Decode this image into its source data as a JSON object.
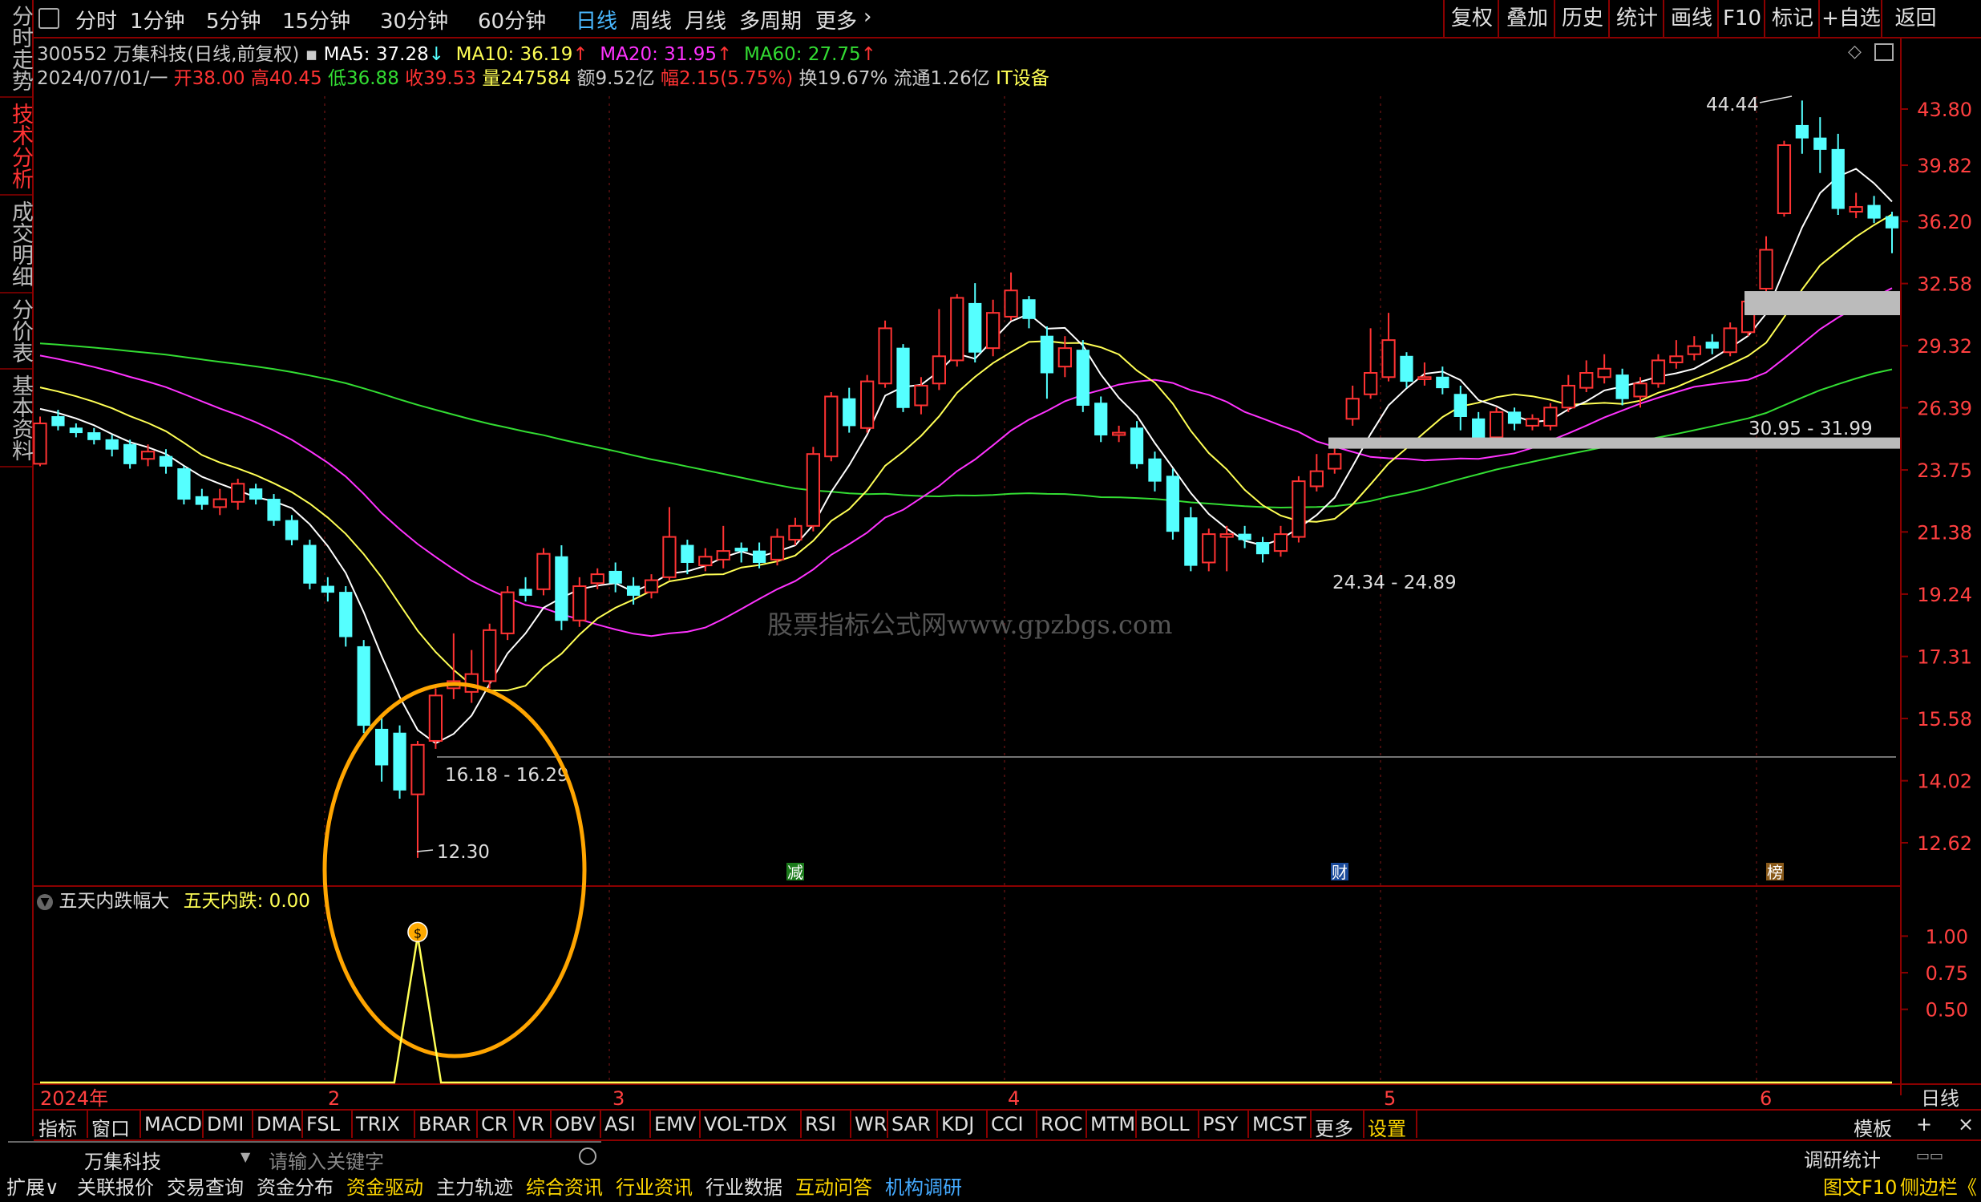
{
  "sidebar": {
    "tabs": [
      "分时走势",
      "技术分析",
      "成交明细",
      "分价表",
      "基本资料"
    ],
    "active_index": 1
  },
  "topbar": {
    "periods": [
      "分时",
      "1分钟",
      "5分钟",
      "15分钟",
      "30分钟",
      "60分钟",
      "日线",
      "周线",
      "月线",
      "多周期",
      "更多"
    ],
    "active_period": "日线",
    "more_arrow": "›",
    "right_items": [
      "复权",
      "叠加",
      "历史",
      "统计",
      "画线",
      "F10",
      "标记",
      "+自选",
      "返回"
    ]
  },
  "info": {
    "stock": "300552 万集科技(日线,前复权)",
    "ma5": "MA5: 37.28",
    "ma10": "MA10: 36.19",
    "ma20": "MA20: 31.95",
    "ma60": "MA60: 27.75",
    "date": "2024/07/01/一",
    "open": "开38.00",
    "high": "高40.45",
    "low": "低36.88",
    "close": "收39.53",
    "vol": "量247584",
    "amount": "额9.52亿",
    "change": "幅2.15(5.75%)",
    "turnover": "换19.67%",
    "float": "流通1.26亿",
    "industry": "IT设备"
  },
  "colors": {
    "ma5": "#ffffff",
    "ma10": "#ffff55",
    "ma20": "#ff33ff",
    "ma60": "#33dd33",
    "up": "#ff3333",
    "down": "#55ffff",
    "accent": "#4ab8ff",
    "frame": "#8b0000",
    "circle": "#ffa500"
  },
  "chart_data": {
    "type": "candlestick",
    "price_axis_ticks": [
      "43.80",
      "39.82",
      "36.20",
      "32.58",
      "29.32",
      "26.39",
      "23.75",
      "21.38",
      "19.24",
      "17.31",
      "15.58",
      "14.02",
      "12.62"
    ],
    "indicator_axis_ticks": [
      "1.00",
      "0.75",
      "0.50"
    ],
    "x_labels": [
      "2024年",
      "2",
      "3",
      "4",
      "5",
      "6"
    ],
    "annotations": {
      "high_label": "44.44",
      "low_label": "12.30",
      "zone1": "16.18 - 16.29",
      "zone2": "24.34 - 24.89",
      "zone3": "30.95 - 31.99"
    },
    "markers": [
      "减",
      "财",
      "榜"
    ],
    "watermark": "股票指标公式网www.gpzbgs.com",
    "indicator": {
      "name": "五天内跌幅大",
      "value_label": "五天内跌: 0.00",
      "peak_value": 1.0,
      "signal_icon": "$"
    },
    "candles": [
      {
        "o": 24.0,
        "c": 25.7,
        "h": 26.0,
        "l": 23.9
      },
      {
        "o": 26.0,
        "c": 25.6,
        "h": 26.3,
        "l": 25.4
      },
      {
        "o": 25.5,
        "c": 25.3,
        "h": 25.7,
        "l": 25.1
      },
      {
        "o": 25.3,
        "c": 25.0,
        "h": 25.5,
        "l": 24.8
      },
      {
        "o": 25.0,
        "c": 24.6,
        "h": 25.2,
        "l": 24.3
      },
      {
        "o": 24.8,
        "c": 24.0,
        "h": 25.0,
        "l": 23.8
      },
      {
        "o": 24.2,
        "c": 24.5,
        "h": 24.8,
        "l": 23.9
      },
      {
        "o": 24.3,
        "c": 23.9,
        "h": 24.6,
        "l": 23.6
      },
      {
        "o": 23.8,
        "c": 22.6,
        "h": 23.9,
        "l": 22.4
      },
      {
        "o": 22.7,
        "c": 22.4,
        "h": 23.0,
        "l": 22.2
      },
      {
        "o": 22.3,
        "c": 22.6,
        "h": 23.0,
        "l": 22.0
      },
      {
        "o": 22.5,
        "c": 23.2,
        "h": 23.4,
        "l": 22.2
      },
      {
        "o": 23.0,
        "c": 22.6,
        "h": 23.2,
        "l": 22.4
      },
      {
        "o": 22.6,
        "c": 21.8,
        "h": 22.8,
        "l": 21.6
      },
      {
        "o": 21.8,
        "c": 21.1,
        "h": 22.0,
        "l": 20.9
      },
      {
        "o": 20.9,
        "c": 19.6,
        "h": 21.1,
        "l": 19.4
      },
      {
        "o": 19.5,
        "c": 19.3,
        "h": 19.8,
        "l": 19.0
      },
      {
        "o": 19.3,
        "c": 17.9,
        "h": 19.5,
        "l": 17.6
      },
      {
        "o": 17.6,
        "c": 15.4,
        "h": 17.8,
        "l": 15.2
      },
      {
        "o": 15.3,
        "c": 14.4,
        "h": 15.6,
        "l": 14.0
      },
      {
        "o": 15.2,
        "c": 13.8,
        "h": 15.4,
        "l": 13.6
      },
      {
        "o": 13.7,
        "c": 14.9,
        "h": 15.0,
        "l": 12.3
      },
      {
        "o": 15.0,
        "c": 16.2,
        "h": 16.4,
        "l": 14.8
      },
      {
        "o": 16.4,
        "c": 16.6,
        "h": 18.0,
        "l": 16.1
      },
      {
        "o": 16.3,
        "c": 16.8,
        "h": 17.5,
        "l": 16.0
      },
      {
        "o": 16.6,
        "c": 18.1,
        "h": 18.3,
        "l": 16.4
      },
      {
        "o": 18.0,
        "c": 19.3,
        "h": 19.5,
        "l": 17.8
      },
      {
        "o": 19.4,
        "c": 19.2,
        "h": 19.8,
        "l": 19.0
      },
      {
        "o": 19.4,
        "c": 20.6,
        "h": 20.8,
        "l": 19.2
      },
      {
        "o": 20.5,
        "c": 18.4,
        "h": 20.9,
        "l": 18.1
      },
      {
        "o": 18.4,
        "c": 19.5,
        "h": 19.8,
        "l": 18.2
      },
      {
        "o": 19.6,
        "c": 19.9,
        "h": 20.1,
        "l": 19.4
      },
      {
        "o": 20.0,
        "c": 19.6,
        "h": 20.3,
        "l": 19.3
      },
      {
        "o": 19.5,
        "c": 19.2,
        "h": 19.8,
        "l": 18.9
      },
      {
        "o": 19.3,
        "c": 19.7,
        "h": 19.9,
        "l": 19.1
      },
      {
        "o": 19.8,
        "c": 21.2,
        "h": 22.3,
        "l": 19.7
      },
      {
        "o": 20.9,
        "c": 20.3,
        "h": 21.1,
        "l": 19.9
      },
      {
        "o": 20.2,
        "c": 20.5,
        "h": 20.8,
        "l": 20.0
      },
      {
        "o": 20.4,
        "c": 20.7,
        "h": 21.6,
        "l": 20.1
      },
      {
        "o": 20.8,
        "c": 20.7,
        "h": 21.0,
        "l": 20.3
      },
      {
        "o": 20.7,
        "c": 20.3,
        "h": 21.0,
        "l": 20.1
      },
      {
        "o": 20.4,
        "c": 21.2,
        "h": 21.5,
        "l": 20.2
      },
      {
        "o": 21.1,
        "c": 21.6,
        "h": 21.9,
        "l": 20.9
      },
      {
        "o": 21.6,
        "c": 24.4,
        "h": 24.7,
        "l": 21.4
      },
      {
        "o": 24.3,
        "c": 26.9,
        "h": 27.1,
        "l": 24.1
      },
      {
        "o": 26.8,
        "c": 25.6,
        "h": 27.3,
        "l": 25.3
      },
      {
        "o": 25.5,
        "c": 27.6,
        "h": 27.9,
        "l": 25.3
      },
      {
        "o": 27.5,
        "c": 30.2,
        "h": 30.6,
        "l": 27.3
      },
      {
        "o": 29.2,
        "c": 26.4,
        "h": 29.4,
        "l": 26.2
      },
      {
        "o": 26.5,
        "c": 27.4,
        "h": 27.8,
        "l": 26.1
      },
      {
        "o": 27.5,
        "c": 28.8,
        "h": 31.2,
        "l": 27.2
      },
      {
        "o": 28.6,
        "c": 31.8,
        "h": 32.0,
        "l": 28.3
      },
      {
        "o": 31.5,
        "c": 29.0,
        "h": 32.6,
        "l": 28.5
      },
      {
        "o": 29.2,
        "c": 31.0,
        "h": 31.7,
        "l": 28.8
      },
      {
        "o": 30.8,
        "c": 32.2,
        "h": 33.2,
        "l": 30.6
      },
      {
        "o": 31.7,
        "c": 30.7,
        "h": 31.9,
        "l": 30.2
      },
      {
        "o": 29.8,
        "c": 28.0,
        "h": 30.3,
        "l": 26.8
      },
      {
        "o": 28.3,
        "c": 29.2,
        "h": 29.8,
        "l": 27.8
      },
      {
        "o": 29.1,
        "c": 26.5,
        "h": 29.6,
        "l": 26.2
      },
      {
        "o": 26.6,
        "c": 25.2,
        "h": 26.9,
        "l": 24.9
      },
      {
        "o": 25.2,
        "c": 25.3,
        "h": 25.6,
        "l": 24.9
      },
      {
        "o": 25.5,
        "c": 24.0,
        "h": 25.8,
        "l": 23.8
      },
      {
        "o": 24.2,
        "c": 23.3,
        "h": 24.5,
        "l": 22.9
      },
      {
        "o": 23.5,
        "c": 21.4,
        "h": 23.8,
        "l": 21.1
      },
      {
        "o": 21.9,
        "c": 20.2,
        "h": 22.3,
        "l": 20.0
      },
      {
        "o": 20.3,
        "c": 21.3,
        "h": 21.5,
        "l": 20.0
      },
      {
        "o": 21.2,
        "c": 21.3,
        "h": 21.6,
        "l": 20.0
      },
      {
        "o": 21.3,
        "c": 21.1,
        "h": 21.6,
        "l": 20.8
      },
      {
        "o": 21.0,
        "c": 20.6,
        "h": 21.2,
        "l": 20.3
      },
      {
        "o": 20.7,
        "c": 21.3,
        "h": 21.6,
        "l": 20.5
      },
      {
        "o": 21.2,
        "c": 23.3,
        "h": 23.5,
        "l": 21.0
      },
      {
        "o": 23.1,
        "c": 23.7,
        "h": 24.4,
        "l": 22.9
      },
      {
        "o": 23.8,
        "c": 24.4,
        "h": 24.7,
        "l": 23.6
      },
      {
        "o": 25.9,
        "c": 26.8,
        "h": 27.4,
        "l": 25.6
      },
      {
        "o": 27.0,
        "c": 28.0,
        "h": 30.2,
        "l": 26.8
      },
      {
        "o": 27.8,
        "c": 29.6,
        "h": 31.0,
        "l": 27.6
      },
      {
        "o": 28.8,
        "c": 27.6,
        "h": 29.0,
        "l": 27.3
      },
      {
        "o": 27.7,
        "c": 27.8,
        "h": 28.5,
        "l": 27.4
      },
      {
        "o": 27.8,
        "c": 27.3,
        "h": 28.3,
        "l": 27.0
      },
      {
        "o": 27.0,
        "c": 26.0,
        "h": 27.4,
        "l": 25.4
      },
      {
        "o": 25.9,
        "c": 25.0,
        "h": 26.2,
        "l": 24.8
      },
      {
        "o": 25.1,
        "c": 26.2,
        "h": 26.4,
        "l": 24.9
      },
      {
        "o": 26.2,
        "c": 25.7,
        "h": 26.4,
        "l": 25.4
      },
      {
        "o": 25.6,
        "c": 25.9,
        "h": 26.1,
        "l": 25.4
      },
      {
        "o": 25.6,
        "c": 26.4,
        "h": 26.6,
        "l": 25.4
      },
      {
        "o": 26.4,
        "c": 27.4,
        "h": 27.9,
        "l": 26.2
      },
      {
        "o": 27.3,
        "c": 28.0,
        "h": 28.6,
        "l": 27.1
      },
      {
        "o": 27.8,
        "c": 28.2,
        "h": 28.9,
        "l": 27.5
      },
      {
        "o": 27.9,
        "c": 26.8,
        "h": 28.2,
        "l": 26.5
      },
      {
        "o": 26.9,
        "c": 27.5,
        "h": 27.8,
        "l": 26.4
      },
      {
        "o": 27.5,
        "c": 28.6,
        "h": 28.9,
        "l": 27.3
      },
      {
        "o": 28.5,
        "c": 28.8,
        "h": 29.6,
        "l": 28.2
      },
      {
        "o": 28.9,
        "c": 29.3,
        "h": 29.8,
        "l": 28.6
      },
      {
        "o": 29.5,
        "c": 29.2,
        "h": 29.9,
        "l": 28.9
      },
      {
        "o": 29.0,
        "c": 30.2,
        "h": 30.5,
        "l": 28.8
      },
      {
        "o": 30.0,
        "c": 31.6,
        "h": 32.0,
        "l": 29.8
      },
      {
        "o": 32.3,
        "c": 34.5,
        "h": 35.3,
        "l": 32.0
      },
      {
        "o": 36.7,
        "c": 41.2,
        "h": 41.5,
        "l": 36.5
      },
      {
        "o": 42.6,
        "c": 41.7,
        "h": 44.44,
        "l": 40.6
      },
      {
        "o": 41.7,
        "c": 40.9,
        "h": 43.2,
        "l": 39.3
      },
      {
        "o": 40.9,
        "c": 37.0,
        "h": 42.0,
        "l": 36.6
      },
      {
        "o": 36.8,
        "c": 37.1,
        "h": 38.0,
        "l": 36.4
      },
      {
        "o": 37.2,
        "c": 36.4,
        "h": 37.8,
        "l": 36.1
      },
      {
        "o": 36.5,
        "c": 35.8,
        "h": 36.8,
        "l": 34.3
      }
    ]
  },
  "bottom_tabs": [
    "指标",
    "窗口",
    "MACD",
    "DMI",
    "DMA",
    "FSL",
    "TRIX",
    "BRAR",
    "CR",
    "VR",
    "OBV",
    "ASI",
    "EMV",
    "VOL-TDX",
    "RSI",
    "WR",
    "SAR",
    "KDJ",
    "CCI",
    "ROC",
    "MTM",
    "BOLL",
    "PSY",
    "MCST",
    "更多",
    "设置"
  ],
  "bottom_right": {
    "template": "模板",
    "plus": "+",
    "period": "日线"
  },
  "footer": {
    "stock_select": "万集科技",
    "search_placeholder": "请输入关键字",
    "research": "调研统计",
    "items": [
      "扩展∨",
      "关联报价",
      "交易查询",
      "资金分布",
      "资金驱动",
      "主力轨迹",
      "综合资讯",
      "行业资讯",
      "行业数据",
      "互动问答",
      "机构调研"
    ],
    "right_items": [
      "图文F10",
      "侧边栏《"
    ]
  }
}
